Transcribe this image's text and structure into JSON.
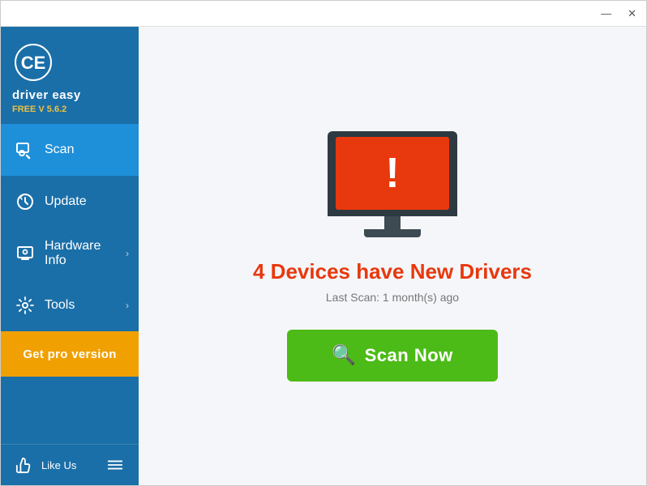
{
  "window": {
    "title": "Driver Easy"
  },
  "titlebar": {
    "minimize_label": "—",
    "close_label": "✕"
  },
  "sidebar": {
    "logo_text": "driver easy",
    "version": "FREE V 5.6.2",
    "nav_items": [
      {
        "id": "scan",
        "label": "Scan",
        "active": true,
        "has_chevron": false
      },
      {
        "id": "update",
        "label": "Update",
        "active": false,
        "has_chevron": false
      },
      {
        "id": "hardware-info",
        "label": "Hardware Info",
        "active": false,
        "has_chevron": true
      },
      {
        "id": "tools",
        "label": "Tools",
        "active": false,
        "has_chevron": true
      }
    ],
    "get_pro_label": "Get pro version",
    "footer": {
      "like_label": "Like Us"
    }
  },
  "main": {
    "alert_title": "4 Devices have New Drivers",
    "last_scan": "Last Scan: 1 month(s) ago",
    "scan_button_label": "Scan Now"
  }
}
